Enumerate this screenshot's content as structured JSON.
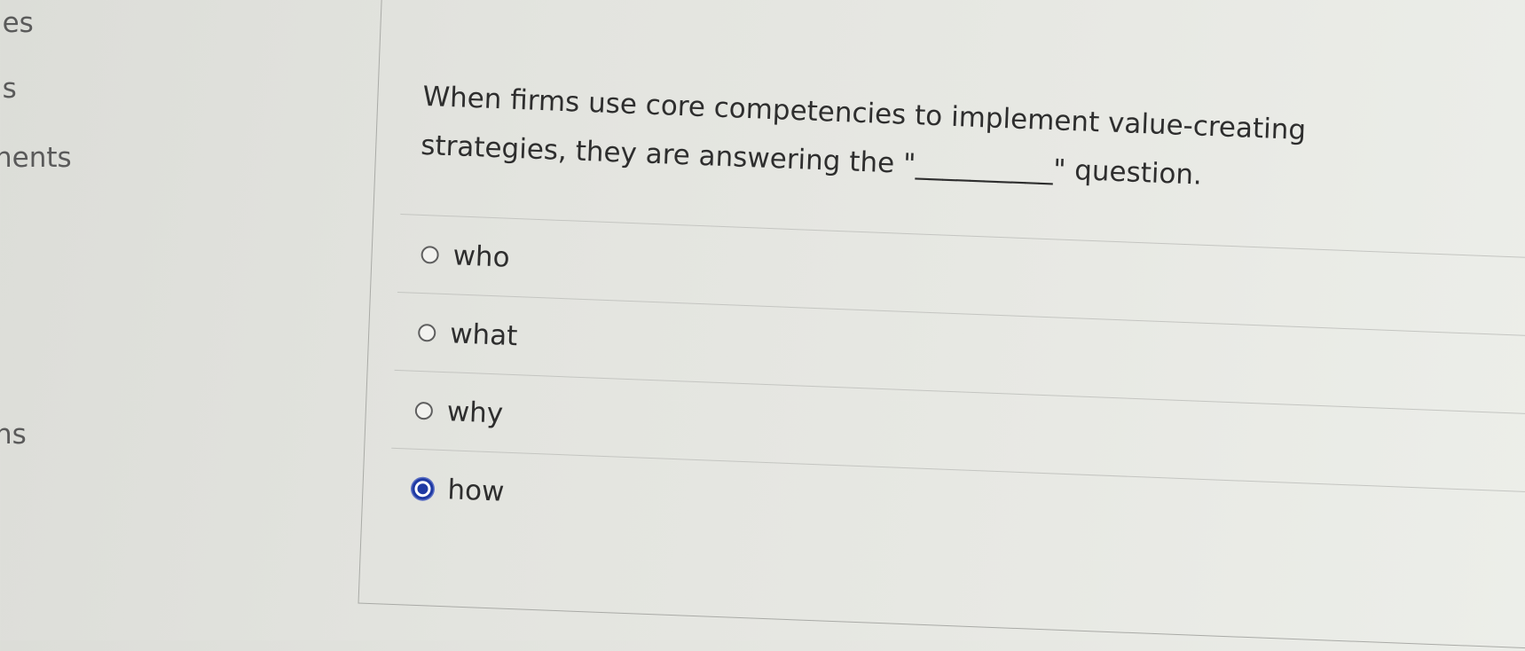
{
  "left_nav": {
    "items": [
      {
        "label": "les"
      },
      {
        "label": "ıs"
      },
      {
        "label": "nents"
      },
      {
        "label": "ns"
      }
    ]
  },
  "question": {
    "text": "When firms use core competencies to implement value-creating strategies, they are answering the \"__________\" question.",
    "options": [
      {
        "label": "who",
        "selected": false
      },
      {
        "label": "what",
        "selected": false
      },
      {
        "label": "why",
        "selected": false
      },
      {
        "label": "how",
        "selected": true
      }
    ]
  },
  "colors": {
    "selected_radio": "#1f3aa3",
    "background": "#e3e4df"
  }
}
